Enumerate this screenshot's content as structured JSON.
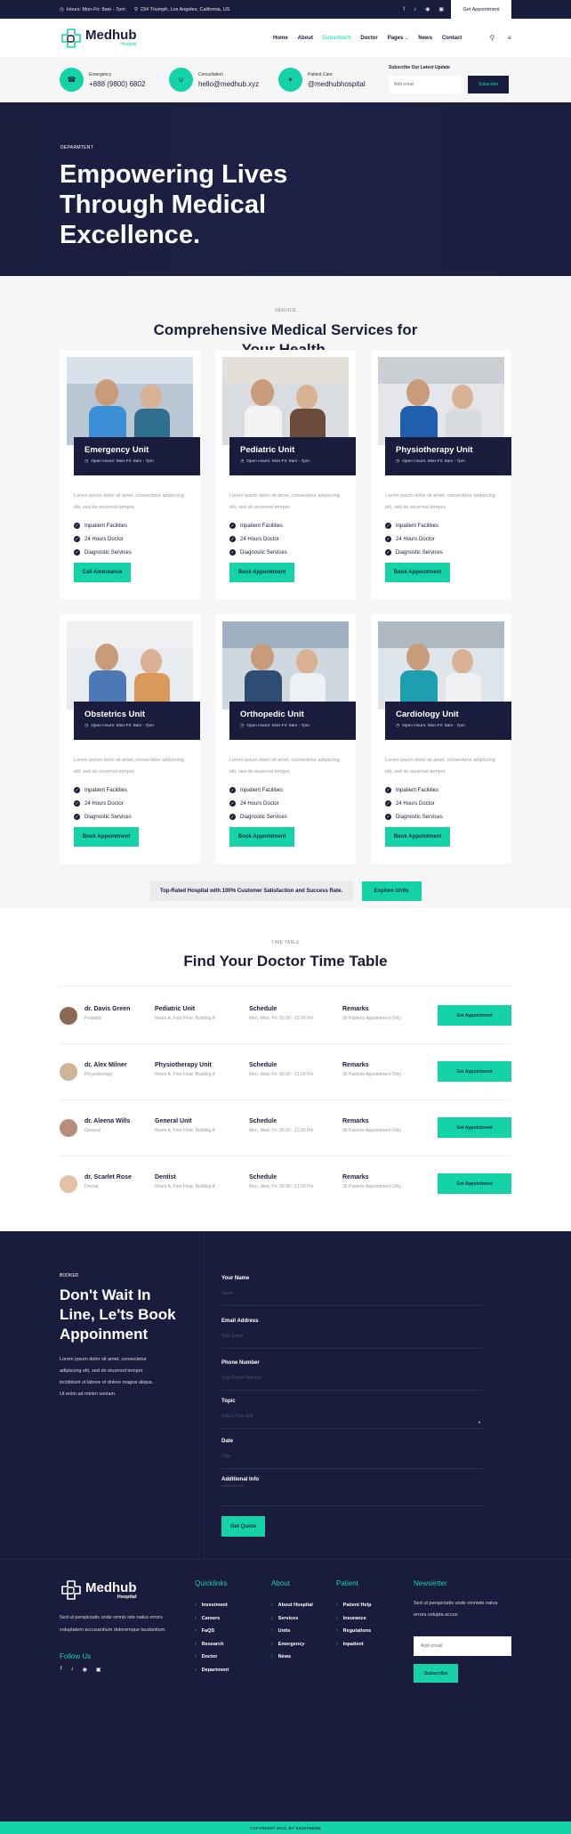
{
  "topbar": {
    "hours": "Hours: Mon-Fri: 8am - 7pm",
    "address": "234 Triumph, Los Angeles, California, US",
    "social": [
      "facebook-icon",
      "tiktok-icon",
      "instagram-icon",
      "linkedin-icon"
    ],
    "appointment_label": "Get Appointment"
  },
  "header": {
    "brand": "Medhub",
    "brand_sub": "Hospital",
    "nav": [
      "Home",
      "About",
      "Department",
      "Doctor",
      "Pages",
      "News",
      "Contact"
    ],
    "active_nav": "Department"
  },
  "contact": {
    "items": [
      {
        "label": "Emergency",
        "value": "+888 (9800) 6802",
        "icon": "emergency-icon"
      },
      {
        "label": "Consultation",
        "value": "hello@medhub.xyz",
        "icon": "stethoscope-icon"
      },
      {
        "label": "Patient Care",
        "value": "@medhubhospital",
        "icon": "twitter-icon"
      }
    ],
    "subscribe_title": "Subscribe Our Latest Update",
    "email_placeholder": "Add email",
    "subscribe_label": "Subscribe"
  },
  "hero": {
    "tag": "DEPARMTENT",
    "line1": "Empowering Lives",
    "line2": "Through Medical",
    "line3": "Excellence."
  },
  "services": {
    "tag": "SERVICE",
    "title_line1": "Comprehensive Medical Services for",
    "title_line2": "Your Health.",
    "cards": [
      {
        "title": "Emergency Unit",
        "hours": "Open Hours: Mon-Fri: 8am - 7pm",
        "desc": "Lorem ipsum dolor sit amet, consectetur adipiscing elit, sed do eiusmod tempor.",
        "features": [
          "Inpatient Facilities",
          "24 Hours Doctor",
          "Diagnostic Services"
        ],
        "cta": "Call Ambulance"
      },
      {
        "title": "Pediatric Unit",
        "hours": "Open Hours: Mon-Fri: 8am - 7pm",
        "desc": "Lorem ipsum dolor sit amet, consectetur adipiscing elit, sed do eiusmod tempor.",
        "features": [
          "Inpatient Facilities",
          "24 Hours Doctor",
          "Diagnostic Services"
        ],
        "cta": "Book Appointment"
      },
      {
        "title": "Physiotherapy Unit",
        "hours": "Open Hours: Mon-Fri: 8am - 7pm",
        "desc": "Lorem ipsum dolor sit amet, consectetur adipiscing elit, sed do eiusmod tempor.",
        "features": [
          "Inpatient Facilities",
          "24 Hours Doctor",
          "Diagnostic Services"
        ],
        "cta": "Book Appointment"
      },
      {
        "title": "Obstetrics Unit",
        "hours": "Open Hours: Mon-Fri: 8am - 7pm",
        "desc": "Lorem ipsum dolor sit amet, consectetur adipiscing elit, sed do eiusmod tempor.",
        "features": [
          "Inpatient Facilities",
          "24 Hours Doctor",
          "Diagnostic Services"
        ],
        "cta": "Book Appointment"
      },
      {
        "title": "Orthopedic Unit",
        "hours": "Open Hours: Mon-Fri: 8am - 7pm",
        "desc": "Lorem ipsum dolor sit amet, consectetur adipiscing elit, sed do eiusmod tempor.",
        "features": [
          "Inpatient Facilities",
          "24 Hours Doctor",
          "Diagnostic Services"
        ],
        "cta": "Book Appointment"
      },
      {
        "title": "Cardiology Unit",
        "hours": "Open Hours: Mon-Fri: 8am - 7pm",
        "desc": "Lorem ipsum dolor sit amet, consectetur adipiscing elit, sed do eiusmod tempor.",
        "features": [
          "Inpatient Facilities",
          "24 Hours Doctor",
          "Diagnostic Services"
        ],
        "cta": "Book Appointment"
      }
    ],
    "note": "Top-Rated Hospital with 100% Customer Satisfaction and Success Rate.",
    "explore_label": "Explore Units"
  },
  "timetable": {
    "tag": "TIME TABLE",
    "title": "Find Your Doctor Time Table",
    "rows": [
      {
        "name": "dr. Davis Green",
        "specialty": "Pediatric",
        "unit": "Pediatric Unit",
        "room": "Room A, First Floor, Building A",
        "schedule_label": "Schedule",
        "schedule": "Mon, Wed, Fri: 05.00 - 21.00 Pm",
        "remarks_label": "Remarks",
        "remarks": "30 Patients Appointment Only",
        "cta": "Get Appointment"
      },
      {
        "name": "dr. Alex Milner",
        "specialty": "Physiotherapy",
        "unit": "Physiotherapy Unit",
        "room": "Room A, First Floor, Building A",
        "schedule_label": "Schedule",
        "schedule": "Mon, Wed, Fri: 05.00 - 21.00 Pm",
        "remarks_label": "Remarks",
        "remarks": "30 Patients Appointment Only",
        "cta": "Get Appointment"
      },
      {
        "name": "dr. Aleena Wills",
        "specialty": "General",
        "unit": "General Unit",
        "room": "Room A, First Floor, Building A",
        "schedule_label": "Schedule",
        "schedule": "Mon, Wed, Fri: 05.00 - 21.00 Pm",
        "remarks_label": "Remarks",
        "remarks": "30 Patients Appointment Only",
        "cta": "Get Appointment"
      },
      {
        "name": "dr. Scarlet Rose",
        "specialty": "Dentist",
        "unit": "Dentist",
        "room": "Room A, First Floor, Building A",
        "schedule_label": "Schedule",
        "schedule": "Mon, Wed, Fri: 05.00 - 21.00 Pm",
        "remarks_label": "Remarks",
        "remarks": "30 Patients Appointment Only",
        "cta": "Get Appointment"
      }
    ]
  },
  "booking": {
    "tag": "BOOKED",
    "title": "Don't Wait In Line, Le'ts Book Appoinment",
    "lede": "Lorem ipsum dolor sit amet, consectetur adipiscing elit, sed do eiusmod tempor incididunt ut labore et dolore magna aliqua. Ut enim ad minim veniam.",
    "fields": [
      {
        "label": "Your Name",
        "placeholder": "Name"
      },
      {
        "label": "Email Address",
        "placeholder": "Your Email"
      },
      {
        "label": "Phone Number",
        "placeholder": "Your Phone Number"
      },
      {
        "label": "Topic",
        "placeholder": "Select Your Unit"
      },
      {
        "label": "Date",
        "placeholder": "Date"
      },
      {
        "label": "Additional Info",
        "placeholder": "Additional Info"
      }
    ],
    "submit_label": "Get Quote"
  },
  "footer": {
    "brand": "Medhub",
    "brand_sub": "Hospital",
    "about": "Sed ut perspiciatis unde omnis iste natus errors voluptatem accusantium doloremque laudantium.",
    "follow_label": "Follow Us",
    "columns": [
      {
        "heading": "Quicklinks",
        "links": [
          "Investment",
          "Careers",
          "FaQS",
          "Research",
          "Doctor",
          "Department"
        ]
      },
      {
        "heading": "About",
        "links": [
          "About Hospital",
          "Services",
          "Units",
          "Emergency",
          "News"
        ]
      },
      {
        "heading": "Patient",
        "links": [
          "Patient Help",
          "Insurance",
          "Regulations",
          "Inpatient"
        ]
      }
    ],
    "newsletter": {
      "heading": "Newsletter",
      "text": "Sed ut perspiciatis unde omniste natus errors volupta accus",
      "placeholder": "Add email",
      "button": "Subscribe"
    },
    "copyright": "COPYRIGHT 2023. BY EIGHTHEME"
  },
  "colors": {
    "navy": "#191c3c",
    "accent": "#14d3a6",
    "light_bg": "#f6f6f7"
  }
}
